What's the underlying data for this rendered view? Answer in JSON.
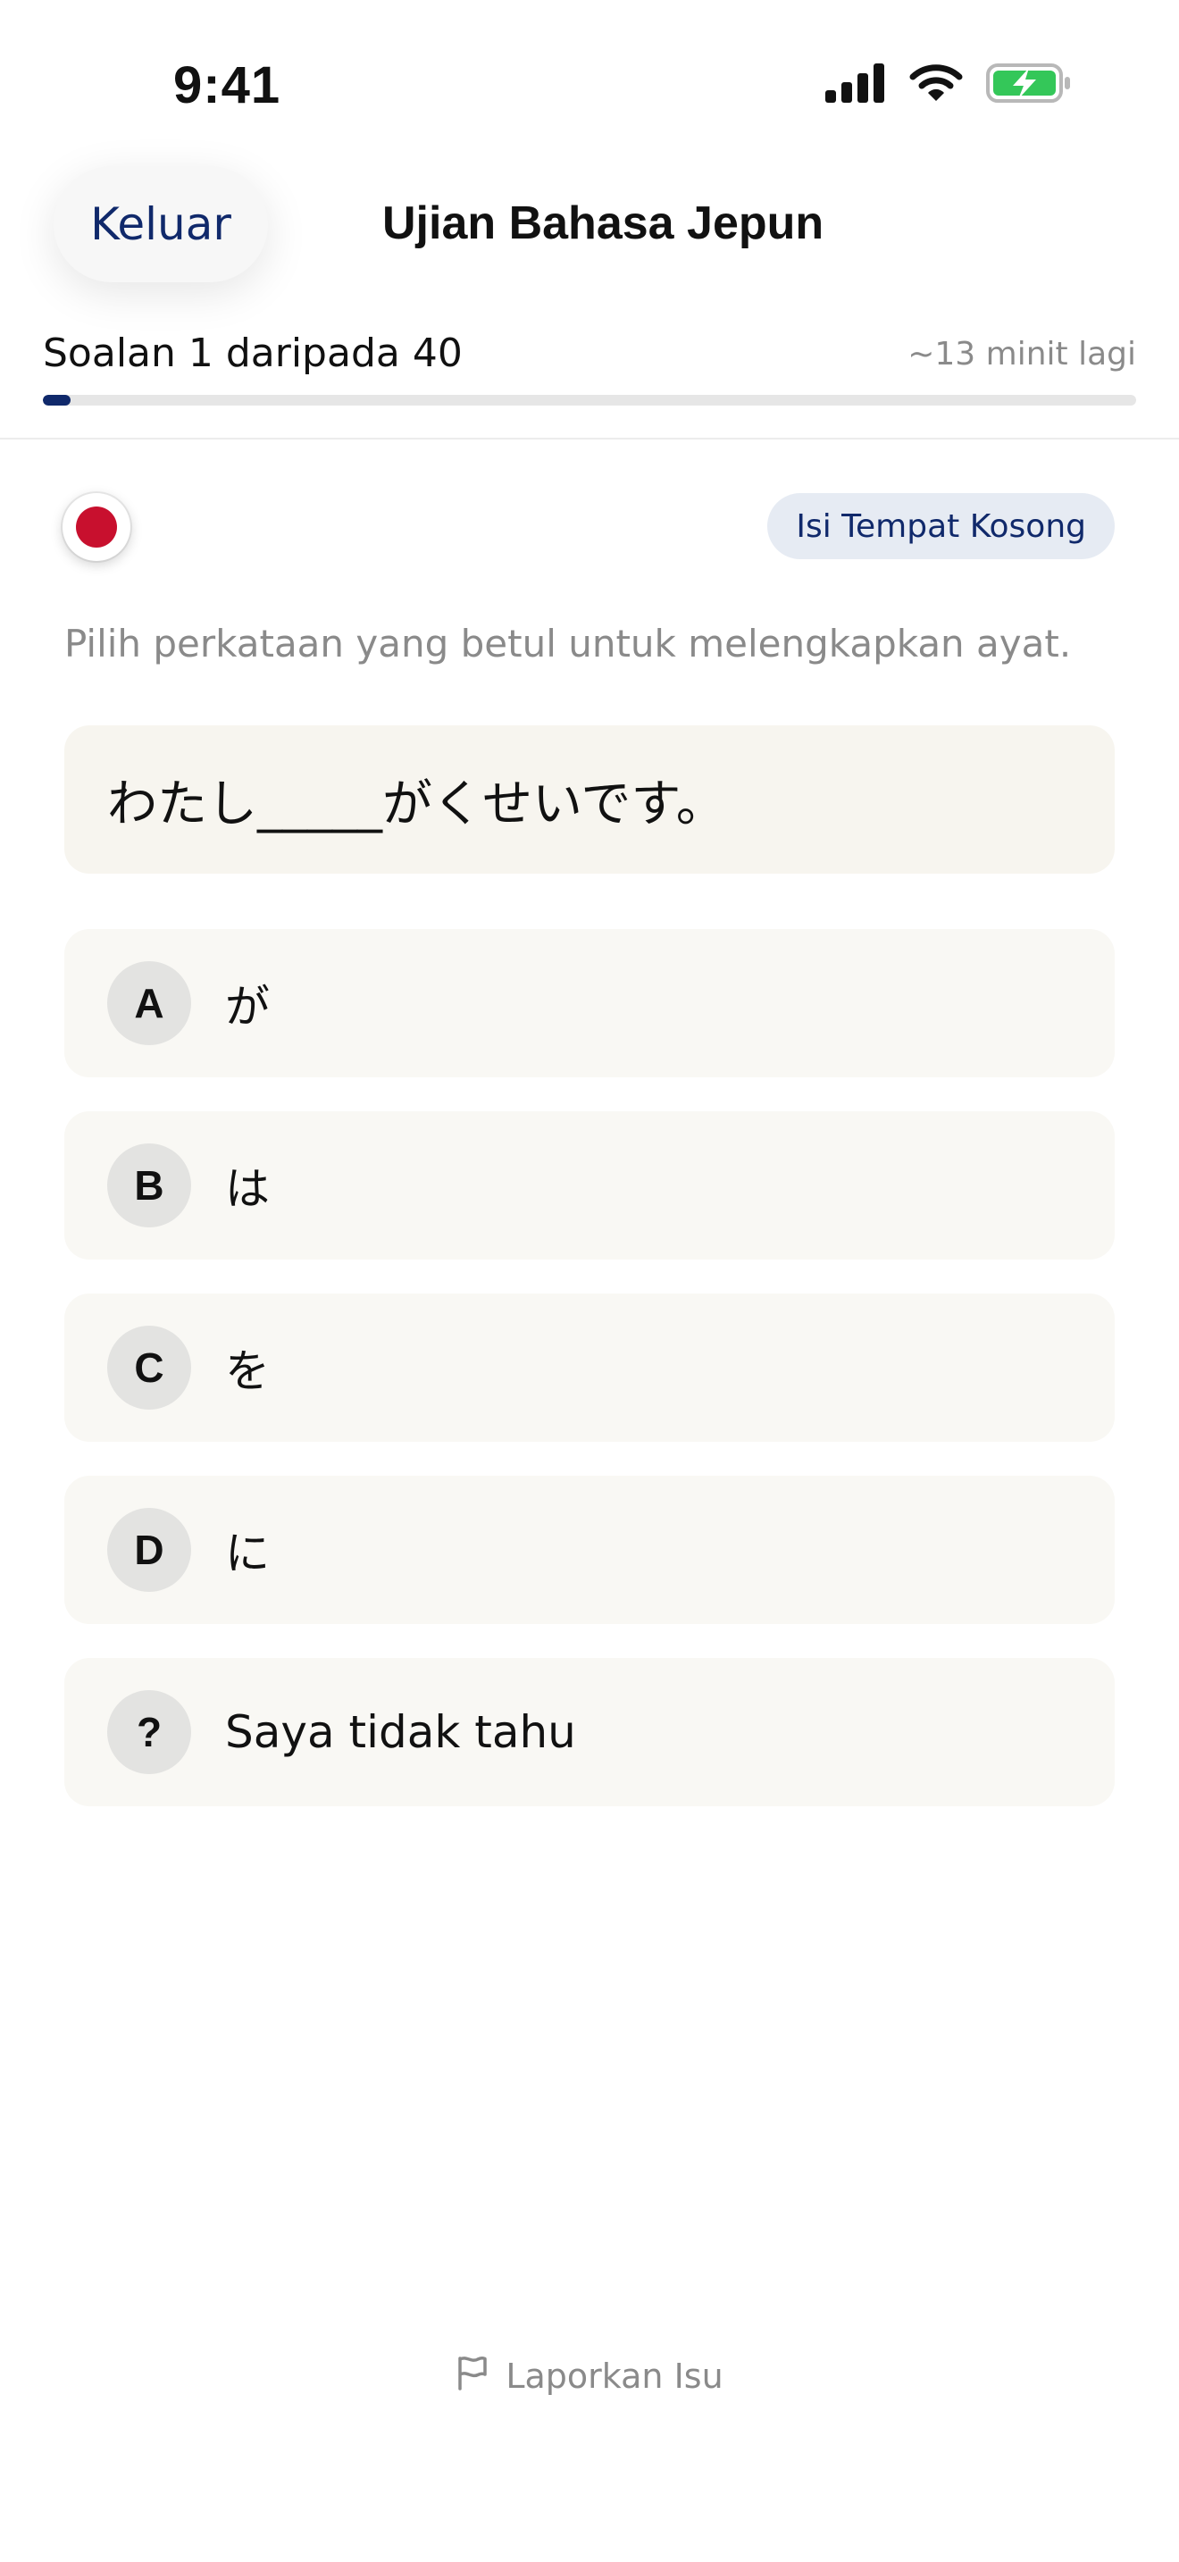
{
  "status_bar": {
    "time": "9:41"
  },
  "header": {
    "exit_label": "Keluar",
    "title": "Ujian Bahasa Jepun"
  },
  "progress": {
    "label": "Soalan 1 daripada 40",
    "time_remaining": "~13 minit lagi",
    "fraction": 0.025,
    "color": "#10296b"
  },
  "question": {
    "language_flag": "japan-flag-icon",
    "type_chip": "Isi Tempat Kosong",
    "instruction": "Pilih perkataan yang betul untuk melengkapkan ayat.",
    "sentence": "わたし_____がくせいです。"
  },
  "options": [
    {
      "letter": "A",
      "text": "が"
    },
    {
      "letter": "B",
      "text": "は"
    },
    {
      "letter": "C",
      "text": "を"
    },
    {
      "letter": "D",
      "text": "に"
    },
    {
      "letter": "?",
      "text": "Saya tidak tahu"
    }
  ],
  "footer": {
    "report_label": "Laporkan Isu"
  },
  "colors": {
    "accent": "#10296b",
    "flag_red": "#c8102e",
    "battery_green": "#34c759"
  }
}
